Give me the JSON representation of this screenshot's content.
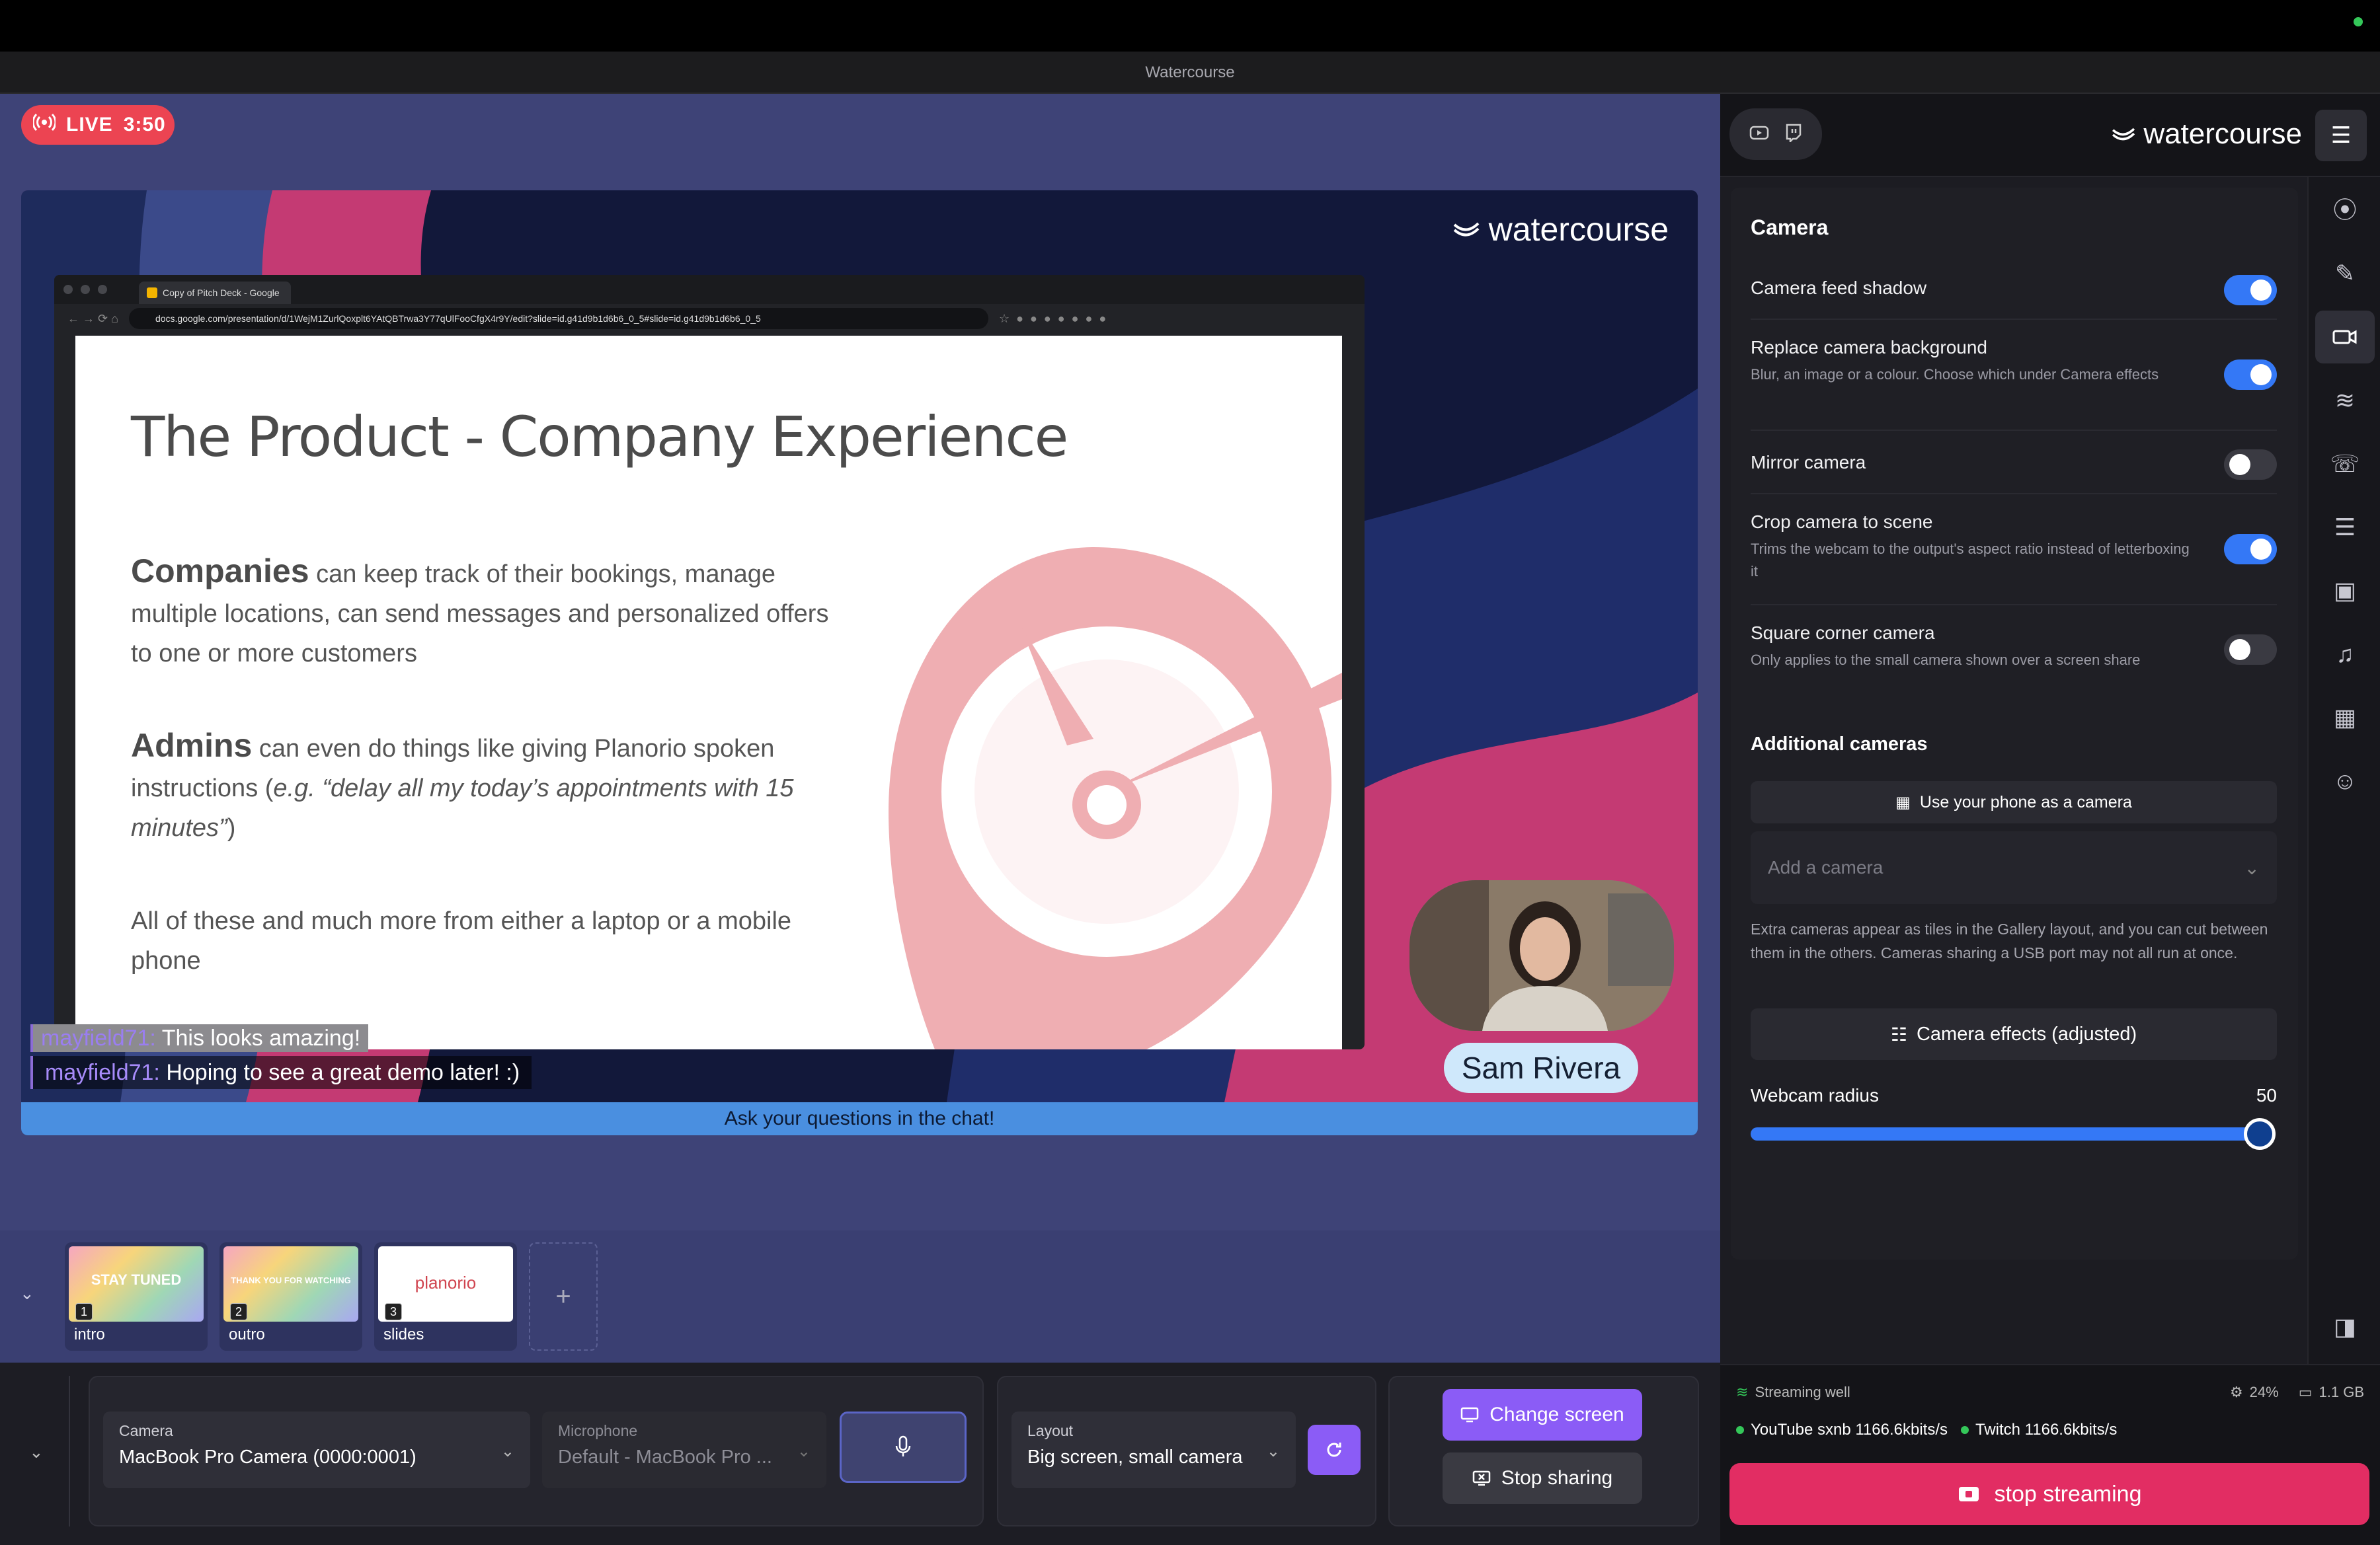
{
  "window": {
    "title": "Watercourse"
  },
  "live": {
    "label": "LIVE",
    "time": "3:50"
  },
  "stage": {
    "brand": "watercourse",
    "browser": {
      "tab_title": "Copy of Pitch Deck - Google",
      "url": "docs.google.com/presentation/d/1WejM1ZurlQoxplt6YAtQBTrwa3Y77qUlFooCfgX4r9Y/edit?slide=id.g41d9b1d6b6_0_5#slide=id.g41d9b1d6b6_0_5"
    },
    "slide": {
      "title": "The Product - Company Experience",
      "p1_bold": "Companies",
      "p1_text": "can keep track of their bookings, manage multiple locations, can send messages and personalized offers to one or more customers",
      "p2_bold": "Admins",
      "p2_text_a": "can even do things like giving Planorio spoken instructions (",
      "p2_text_em": "e.g. “delay all my today’s appointments with 15 minutes”",
      "p2_text_b": ")",
      "p3_text": "All of these and much more from either a laptop or a mobile phone"
    },
    "presenter_name": "Sam Rivera",
    "chat": [
      {
        "user": "mayfield71:",
        "text": "This looks amazing!"
      },
      {
        "user": "mayfield71:",
        "text": "Hoping to see a great demo later! :)"
      }
    ],
    "ticker": "Ask your questions in the chat!"
  },
  "scenes": [
    {
      "num": "1",
      "label": "intro",
      "thumb_text": "STAY TUNED"
    },
    {
      "num": "2",
      "label": "outro",
      "thumb_text": "THANK YOU FOR WATCHING"
    },
    {
      "num": "3",
      "label": "slides",
      "thumb_text": "planorio"
    }
  ],
  "add_scene": "+",
  "controls": {
    "camera_caption": "Camera",
    "camera_value": "MacBook Pro Camera (0000:0001)",
    "mic_caption": "Microphone",
    "mic_value": "Default - MacBook Pro ...",
    "layout_caption": "Layout",
    "layout_value": "Big screen, small camera",
    "change_screen": "Change screen",
    "stop_sharing": "Stop sharing"
  },
  "right": {
    "brand": "watercourse",
    "section_camera": "Camera",
    "rows": [
      {
        "title": "Camera feed shadow",
        "desc": "",
        "on": true
      },
      {
        "title": "Replace camera background",
        "desc": "Blur, an image or a colour. Choose which under Camera effects",
        "on": true
      },
      {
        "title": "Mirror camera",
        "desc": "",
        "on": false
      },
      {
        "title": "Crop camera to scene",
        "desc": "Trims the webcam to the output's aspect ratio instead of letterboxing it",
        "on": true
      },
      {
        "title": "Square corner camera",
        "desc": "Only applies to the small camera shown over a screen share",
        "on": false
      }
    ],
    "section_additional": "Additional cameras",
    "phone_button": "Use your phone as a camera",
    "add_camera_placeholder": "Add a camera",
    "extra_note": "Extra cameras appear as tiles in the Gallery layout, and you can cut between them in the others. Cameras sharing a USB port may not all run at once.",
    "effects_button": "Camera effects (adjusted)",
    "webcam_radius_label": "Webcam radius",
    "webcam_radius_value": "50",
    "webcam_radius_fraction": 1.0,
    "status": "Streaming well",
    "cpu": "24%",
    "memory": "1.1 GB",
    "youtube": "YouTube sxnb 1166.6kbits/s",
    "twitch": "Twitch 1166.6kbits/s",
    "stop_streaming": "stop streaming"
  },
  "colors": {
    "accent": "#3478f6",
    "live": "#ec4452",
    "stop": "#e22d63",
    "purple": "#8b5cf6",
    "stage_bg": "#3e4377"
  }
}
